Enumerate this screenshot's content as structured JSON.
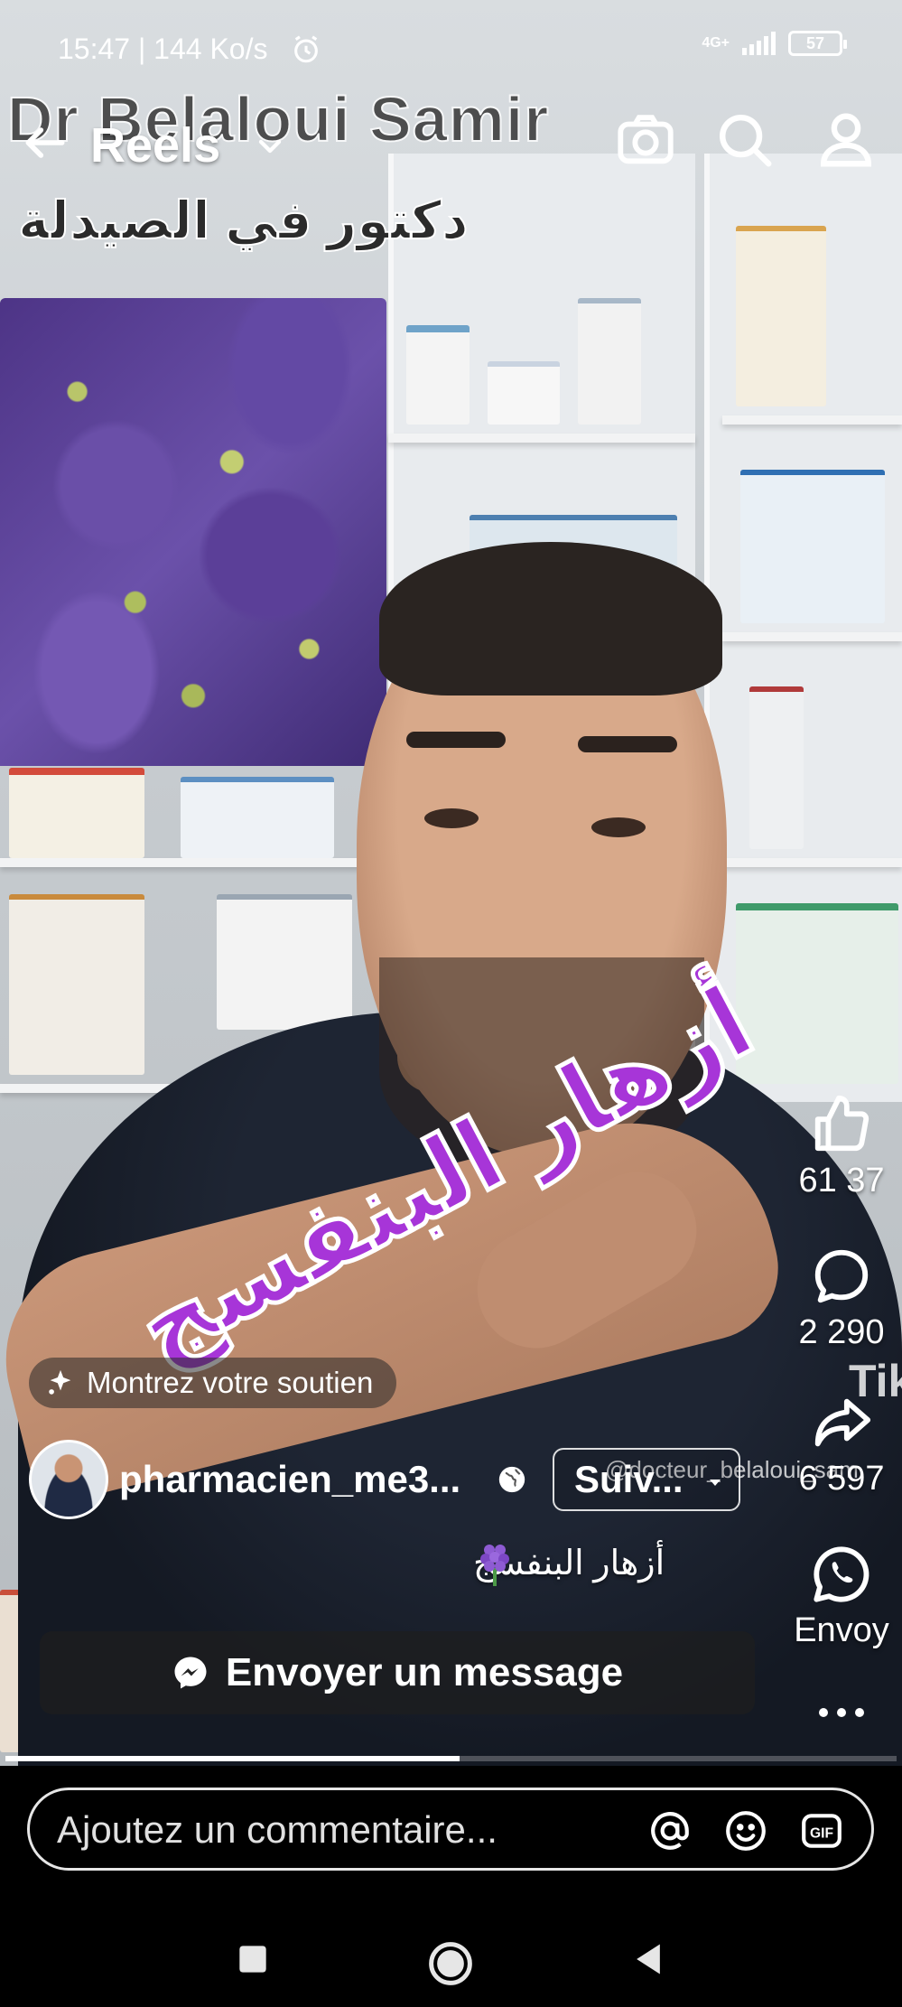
{
  "status_bar": {
    "time": "15:47 | 144 Ko/s",
    "network": "4G+",
    "battery": "57"
  },
  "video": {
    "title_overlay": "Dr Belaloui Samir",
    "subtitle_overlay": "دكتور في الصيدلة",
    "topic_overlay": "أزهار البنفسج",
    "watermark": "@docteur_belaloui_sam",
    "tiktok_mark": "TikTo"
  },
  "nav": {
    "title": "Reels"
  },
  "rail": {
    "likes": "61 37",
    "comments": "2 290",
    "shares": "6 597",
    "whatsapp_label": "Envoy"
  },
  "support": {
    "label": "Montrez votre soutien"
  },
  "author": {
    "name": "pharmacien_me3...",
    "follow_label": "Suiv..."
  },
  "caption": {
    "text": "أزهار البنفسج"
  },
  "message_button": {
    "label": "Envoyer un message"
  },
  "playback": {
    "progress_fraction": 0.51
  },
  "comment": {
    "placeholder": "Ajoutez un commentaire...",
    "gif_label": "GIF"
  },
  "colors": {
    "overlay_purple": "#a735d8",
    "background": "#000000",
    "text": "#ffffff"
  },
  "icons": {
    "back": "arrow-left-icon",
    "camera": "camera-icon",
    "search": "search-icon",
    "profile": "person-icon",
    "like": "thumbs-up-icon",
    "comment": "speech-bubble-icon",
    "share": "share-arrow-icon",
    "whatsapp": "whatsapp-icon",
    "messenger": "messenger-icon",
    "mention": "at-icon",
    "emoji": "smiley-icon",
    "gif": "gif-icon"
  }
}
